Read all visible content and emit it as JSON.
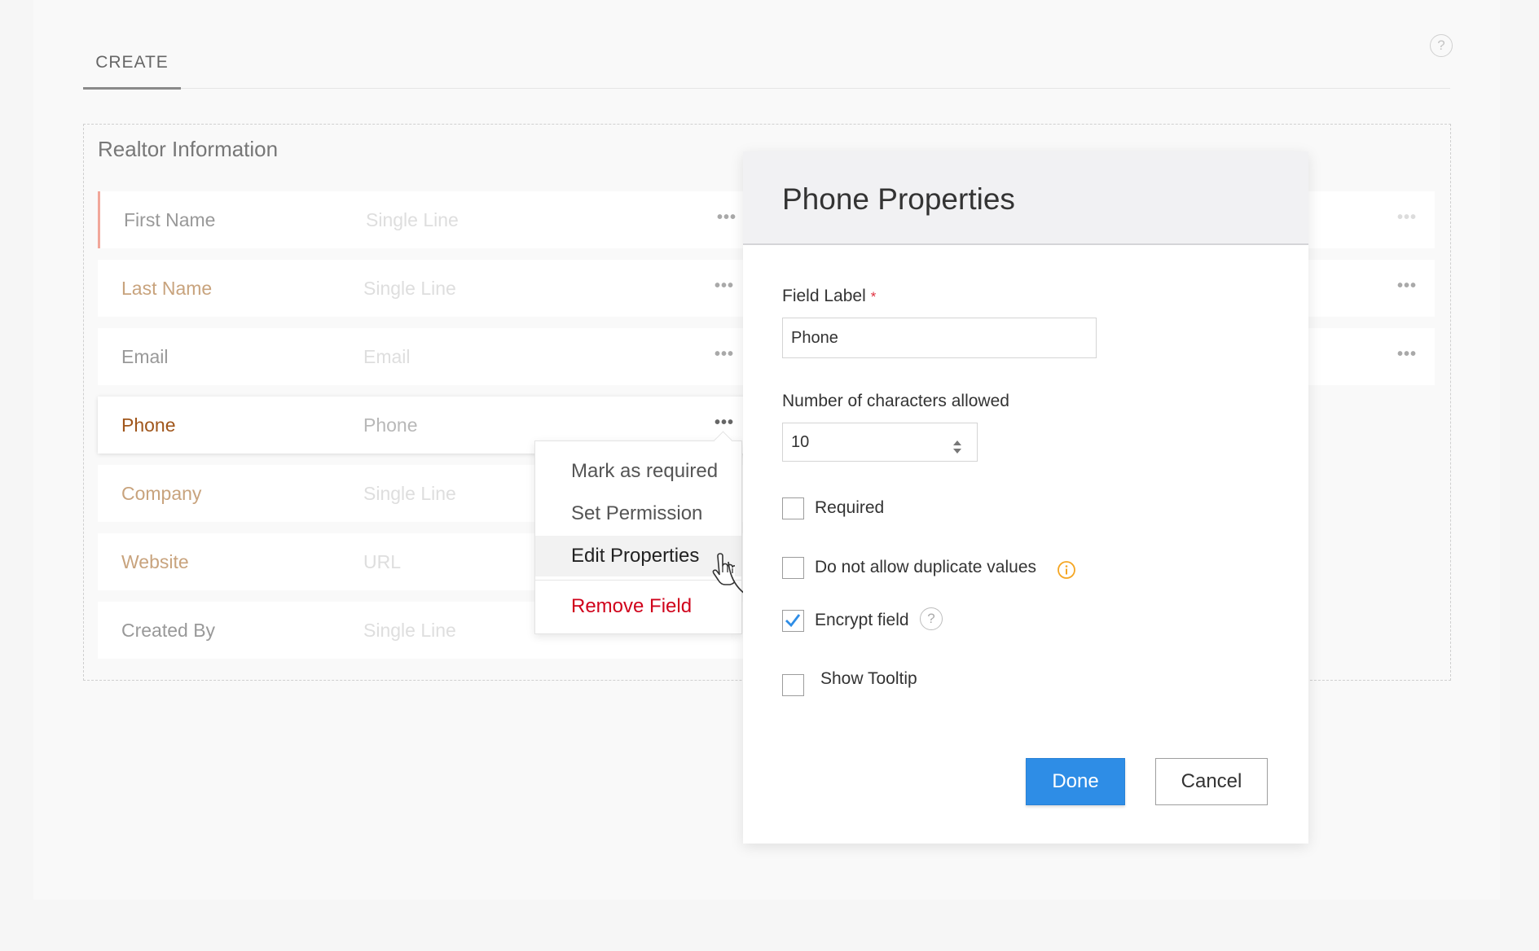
{
  "header": {
    "tab_label": "CREATE",
    "help_glyph": "?"
  },
  "section": {
    "title": "Realtor Information",
    "fields": [
      {
        "label": "First Name",
        "type": "Single Line"
      },
      {
        "label": "Last Name",
        "type": "Single Line"
      },
      {
        "label": "Email",
        "type": "Email"
      },
      {
        "label": "Phone",
        "type": "Phone"
      },
      {
        "label": "Company",
        "type": "Single Line"
      },
      {
        "label": "Website",
        "type": "URL"
      },
      {
        "label": "Created By",
        "type": "Single Line"
      }
    ],
    "more_glyph": "•••"
  },
  "context_menu": {
    "items": [
      "Mark as required",
      "Set Permission",
      "Edit Properties"
    ],
    "remove_label": "Remove Field",
    "hovered_item": "Edit Properties"
  },
  "dialog": {
    "title": "Phone Properties",
    "field_label_caption": "Field Label",
    "required_marker": "*",
    "field_label_value": "Phone",
    "max_chars_caption": "Number of characters allowed",
    "max_chars_value": "10",
    "options": [
      {
        "label": "Required",
        "checked": false
      },
      {
        "label": "Do not allow duplicate values",
        "checked": false
      },
      {
        "label": "Encrypt field",
        "checked": true
      },
      {
        "label": "Show Tooltip",
        "checked": false
      }
    ],
    "help_glyph": "?",
    "done_label": "Done",
    "cancel_label": "Cancel"
  },
  "colors": {
    "accent_blue": "#2e8de6",
    "danger_red": "#d0021b",
    "info_orange": "#f5a623",
    "required_marker": "#f1a79a"
  }
}
